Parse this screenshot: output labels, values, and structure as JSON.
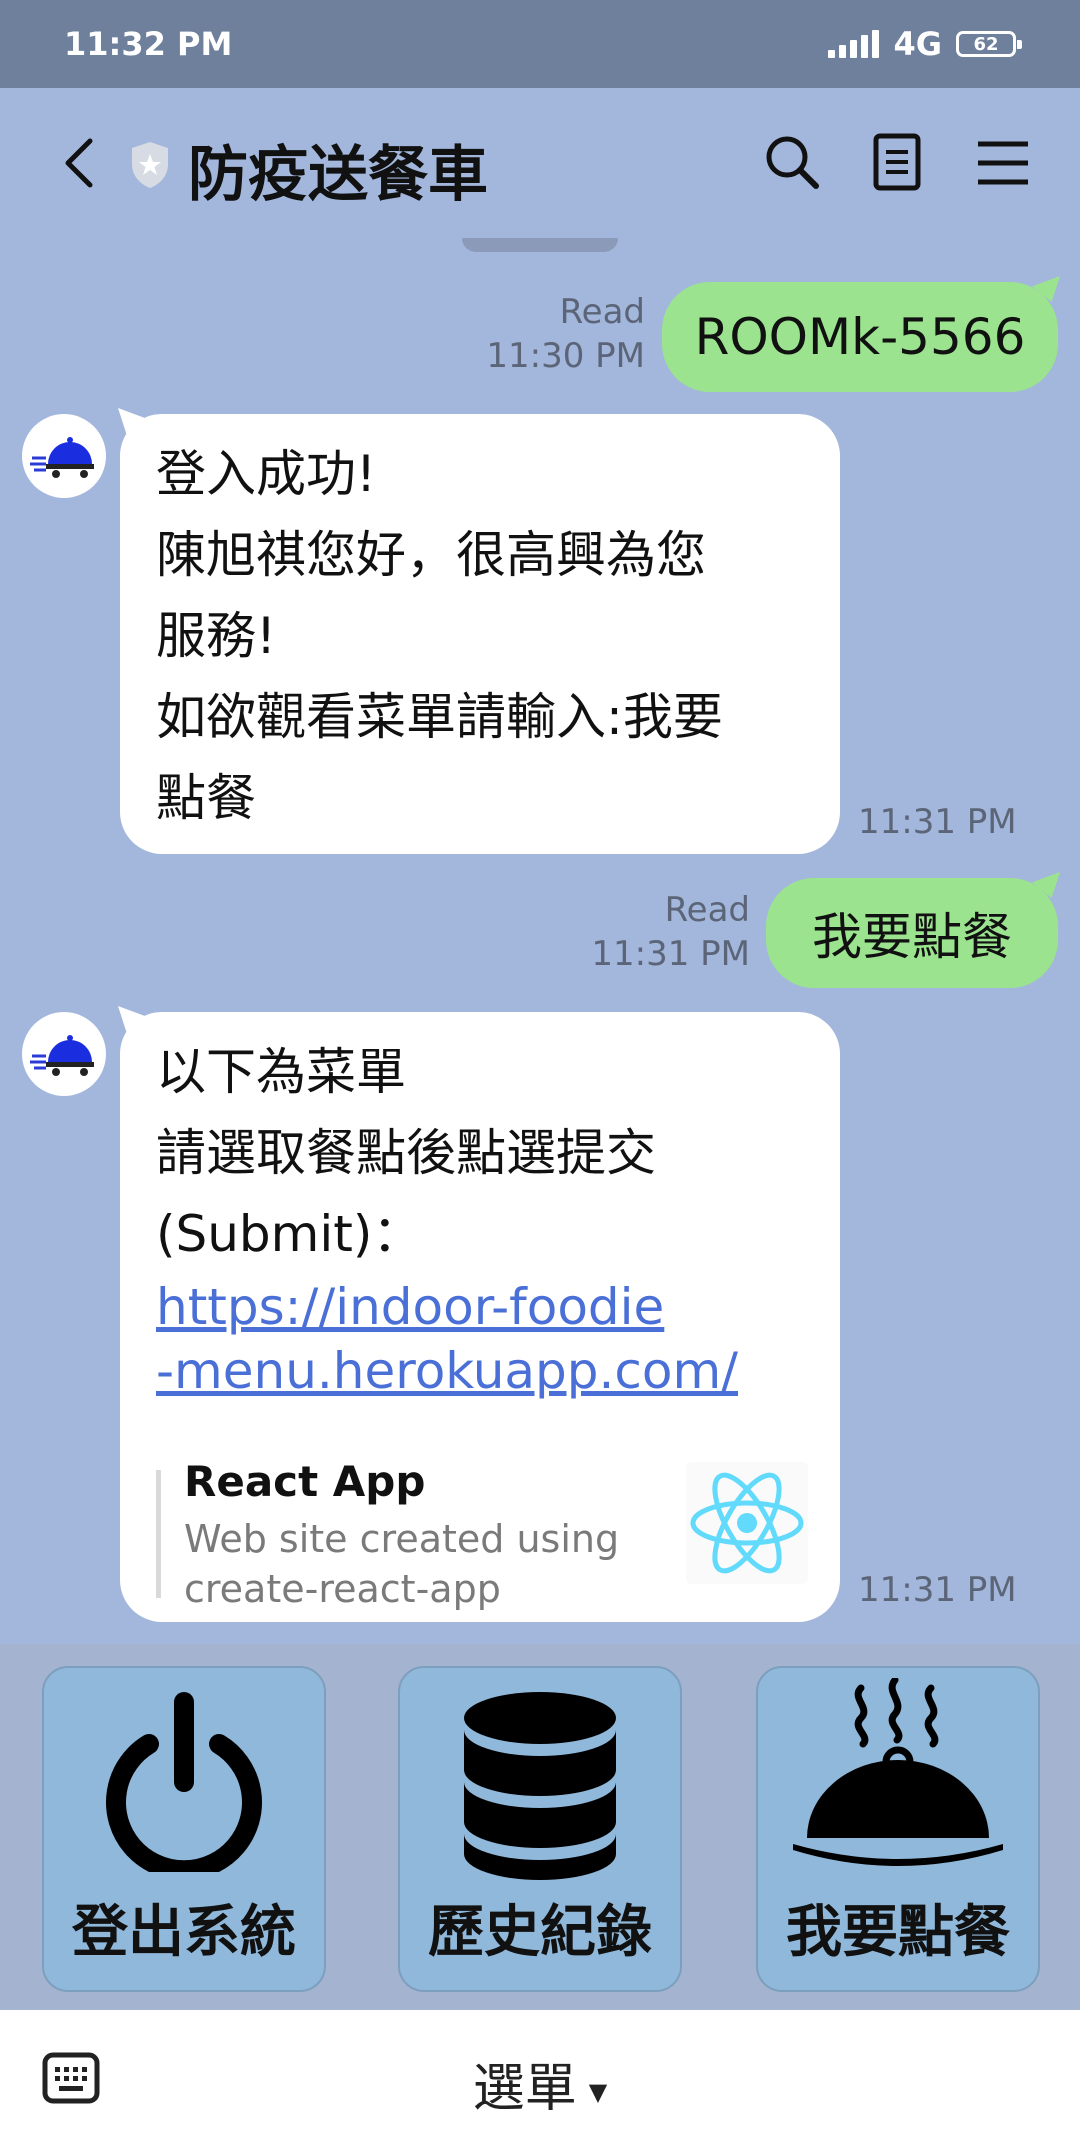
{
  "status_bar": {
    "time": "11:32 PM",
    "network": "4G",
    "battery": "62"
  },
  "header": {
    "title": "防疫送餐車",
    "icons": [
      "back-icon",
      "shield-icon",
      "search-icon",
      "notes-icon",
      "menu-icon"
    ]
  },
  "messages": [
    {
      "direction": "outgoing",
      "read_label": "Read",
      "time": "11:30 PM",
      "text": "ROOMk-5566"
    },
    {
      "direction": "incoming",
      "time": "11:31 PM",
      "lines": [
        "登入成功!",
        "陳旭祺您好，很高興為您",
        "服務!",
        "如欲觀看菜單請輸入:我要",
        "點餐"
      ]
    },
    {
      "direction": "outgoing",
      "read_label": "Read",
      "time": "11:31 PM",
      "text": "我要點餐"
    },
    {
      "direction": "incoming",
      "time": "11:31 PM",
      "lines": [
        "以下為菜單",
        "請選取餐點後點選提交",
        "(Submit)："
      ],
      "link_lines": [
        "https://indoor-foodie",
        "-menu.herokuapp.com/"
      ],
      "preview": {
        "title": "React App",
        "description": "Web site created using create-react-app",
        "logo": "react-logo-icon"
      }
    }
  ],
  "rich_menu": {
    "buttons": [
      {
        "label": "登出系統",
        "icon": "power-icon"
      },
      {
        "label": "歷史紀錄",
        "icon": "database-icon"
      },
      {
        "label": "我要點餐",
        "icon": "food-cloche-icon"
      }
    ]
  },
  "bottom_bar": {
    "menu_label": "選單",
    "keyboard_icon": "keyboard-icon"
  },
  "colors": {
    "chat_background": "#a3b6dc",
    "outgoing_bubble": "#9be38f",
    "incoming_bubble": "#ffffff",
    "link": "#4a6fd6",
    "rich_menu_button": "#8fb8da",
    "status_bar": "#6e809c"
  }
}
